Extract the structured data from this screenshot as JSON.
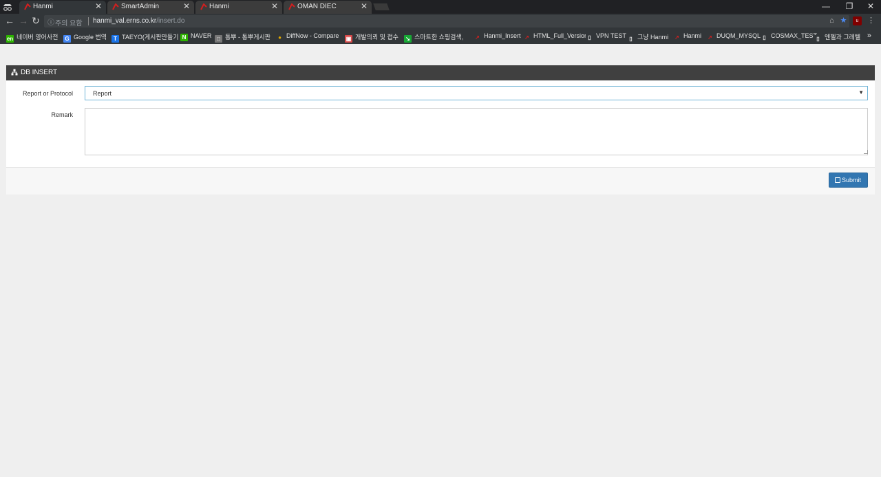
{
  "browser": {
    "tabs": [
      {
        "title": "Hanmi",
        "close": "✕"
      },
      {
        "title": "SmartAdmin",
        "close": "✕"
      },
      {
        "title": "Hanmi",
        "close": "✕"
      },
      {
        "title": "OMAN DIEC",
        "close": "✕"
      }
    ],
    "omnibox": {
      "security_label": "주의 요함",
      "url_host": "hanmi_val.erns.co.kr",
      "url_path": "/insert.do"
    },
    "bookmarks": [
      {
        "label": "네이버 영어사전",
        "icon": "naver-dict-icon",
        "color": "#2db400",
        "glyph": "en"
      },
      {
        "label": "Google 번역",
        "icon": "google-translate-icon",
        "color": "#4285f4",
        "glyph": "G"
      },
      {
        "label": "TAEYO(게시판만들기",
        "icon": "taeyo-icon",
        "color": "#1a73e8",
        "glyph": "T"
      },
      {
        "label": "NAVER",
        "icon": "naver-icon",
        "color": "#2db400",
        "glyph": "N"
      },
      {
        "label": "통뿌 - 통뿌게시판",
        "icon": "board-icon",
        "color": "#777777",
        "glyph": "□"
      },
      {
        "label": "DiffNow - Compare",
        "icon": "diffnow-icon",
        "color": "#e0a800",
        "glyph": "●"
      },
      {
        "label": "개발의뢰 및 접수",
        "icon": "request-icon",
        "color": "#d84a4a",
        "glyph": "▣"
      },
      {
        "label": "스마트한 쇼핑검색,",
        "icon": "shopping-icon",
        "color": "#18a835",
        "glyph": "↘"
      },
      {
        "label": "Hanmi_Insert",
        "icon": "hanmi-icon",
        "color": "#cc2020",
        "glyph": "↗"
      },
      {
        "label": "HTML_Full_Version",
        "icon": "hanmi-icon",
        "color": "#cc2020",
        "glyph": "↗"
      },
      {
        "label": "VPN TEST",
        "icon": "page-icon",
        "color": "#323639",
        "glyph": "▯"
      },
      {
        "label": "그냥 Hanmi",
        "icon": "page-icon",
        "color": "#323639",
        "glyph": "▯"
      },
      {
        "label": "Hanmi",
        "icon": "hanmi-icon",
        "color": "#cc2020",
        "glyph": "↗"
      },
      {
        "label": "DUQM_MYSQL",
        "icon": "hanmi-icon",
        "color": "#cc2020",
        "glyph": "↗"
      },
      {
        "label": "COSMAX_TEST",
        "icon": "page-icon",
        "color": "#323639",
        "glyph": "▯"
      },
      {
        "label": "엔젤과 그레텔",
        "icon": "page-icon",
        "color": "#323639",
        "glyph": "▯"
      }
    ],
    "bookmarks_more": "»"
  },
  "widget": {
    "title": "DB INSERT",
    "fields": {
      "report_protocol_label": "Report or Protocol",
      "report_protocol_value": "Report",
      "remark_label": "Remark",
      "remark_value": ""
    },
    "submit_label": "Submit"
  },
  "colors": {
    "header_bg": "#404040",
    "submit_bg": "#3276b1",
    "select_border": "#6fb3d6"
  }
}
